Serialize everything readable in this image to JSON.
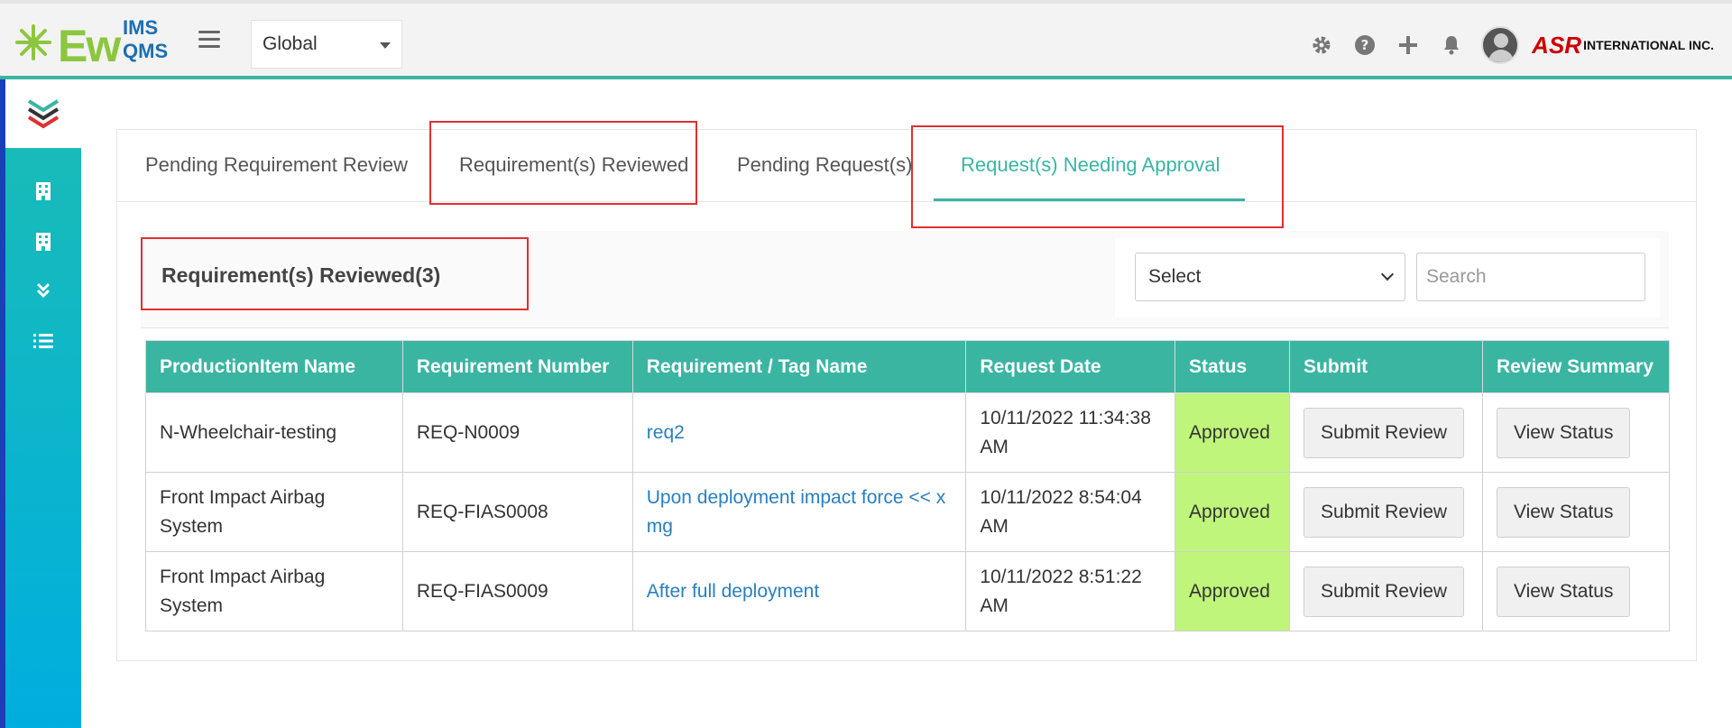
{
  "header": {
    "logo": {
      "main": "Ew",
      "top": "IMS",
      "bottom": "QMS"
    },
    "scope_select": {
      "value": "Global"
    },
    "company_mark": "ASR",
    "company_name": "INTERNATIONAL INC.",
    "icons": [
      "gear-icon",
      "help-icon",
      "plus-icon",
      "bell-icon",
      "avatar"
    ]
  },
  "sidebar": {
    "items": [
      {
        "icon": "chevrons-logo-icon"
      },
      {
        "icon": "building-icon"
      },
      {
        "icon": "building-icon"
      },
      {
        "icon": "double-chevron-down-icon"
      },
      {
        "icon": "list-icon"
      }
    ]
  },
  "tabs": [
    {
      "label": "Pending Requirement Review",
      "active": false
    },
    {
      "label": "Requirement(s) Reviewed",
      "active": false
    },
    {
      "label": "Pending Request(s)",
      "active": false
    },
    {
      "label": "Request(s) Needing Approval",
      "active": true
    }
  ],
  "section": {
    "title": "Requirement(s) Reviewed(3)",
    "filter_select": "Select",
    "search_placeholder": "Search"
  },
  "table": {
    "columns": [
      "ProductionItem Name",
      "Requirement Number",
      "Requirement / Tag Name",
      "Request Date",
      "Status",
      "Submit",
      "Review Summary"
    ],
    "rows": [
      {
        "item": "N-Wheelchair-testing",
        "number": "REQ-N0009",
        "tag": "req2",
        "date": "10/11/2022 11:34:38 AM",
        "status": "Approved",
        "submit": "Submit Review",
        "summary": "View Status"
      },
      {
        "item": "Front Impact Airbag System",
        "number": "REQ-FIAS0008",
        "tag": "Upon deployment impact force << x mg",
        "date": "10/11/2022 8:54:04 AM",
        "status": "Approved",
        "submit": "Submit Review",
        "summary": "View Status"
      },
      {
        "item": "Front Impact Airbag System",
        "number": "REQ-FIAS0009",
        "tag": "After full deployment",
        "date": "10/11/2022 8:51:22 AM",
        "status": "Approved",
        "submit": "Submit Review",
        "summary": "View Status"
      }
    ]
  },
  "colors": {
    "accent": "#3ab5a2",
    "approved": "#bff57a",
    "link": "#2a7fbf",
    "highlight": "#e03030"
  }
}
